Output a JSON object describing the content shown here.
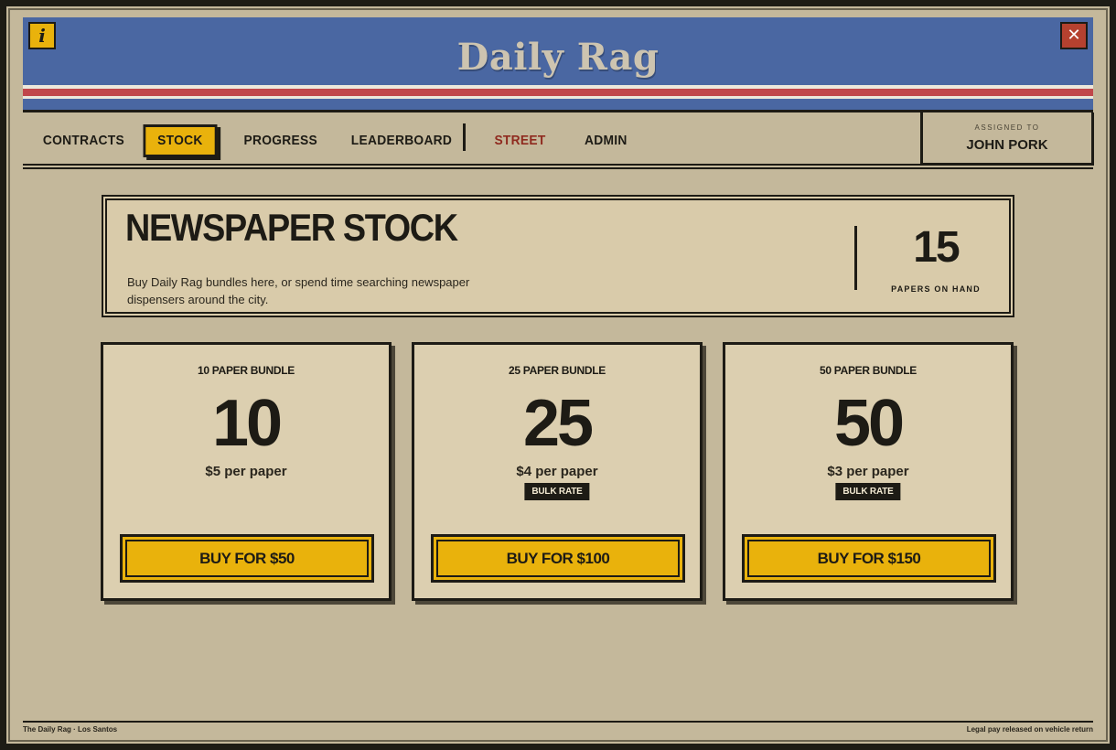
{
  "header": {
    "title": "Daily Rag",
    "info_icon": "i",
    "close_icon": "✕"
  },
  "nav": {
    "tabs": [
      {
        "label": "CONTRACTS"
      },
      {
        "label": "STOCK",
        "active": true
      },
      {
        "label": "PROGRESS"
      },
      {
        "label": "LEADERBOARD"
      },
      {
        "label": "STREET"
      },
      {
        "label": "ADMIN"
      }
    ],
    "assigned_label": "ASSIGNED TO",
    "assigned_name": "JOHN PORK"
  },
  "stock": {
    "title": "NEWSPAPER STOCK",
    "description": "Buy Daily Rag bundles here, or spend time searching newspaper dispensers around the city.",
    "papers_on_hand": "15",
    "papers_on_hand_label": "PAPERS ON HAND"
  },
  "bundles": [
    {
      "name": "10 PAPER BUNDLE",
      "qty": "10",
      "price": "$5 per paper",
      "badge": "",
      "button": "BUY FOR $50"
    },
    {
      "name": "25 PAPER BUNDLE",
      "qty": "25",
      "price": "$4 per paper",
      "badge": "BULK RATE",
      "button": "BUY FOR $100"
    },
    {
      "name": "50 PAPER BUNDLE",
      "qty": "50",
      "price": "$3 per paper",
      "badge": "BULK RATE",
      "button": "BUY FOR $150"
    }
  ],
  "footer": {
    "left": "The Daily Rag · Los Santos",
    "right": "Legal pay released on vehicle return"
  },
  "colors": {
    "accent_yellow": "#e9b20c",
    "masthead_blue": "#4a67a2",
    "stripe_red": "#c0474b",
    "street_red": "#8f2a1f",
    "ink": "#1d1b15",
    "paper": "#dccfb0"
  }
}
